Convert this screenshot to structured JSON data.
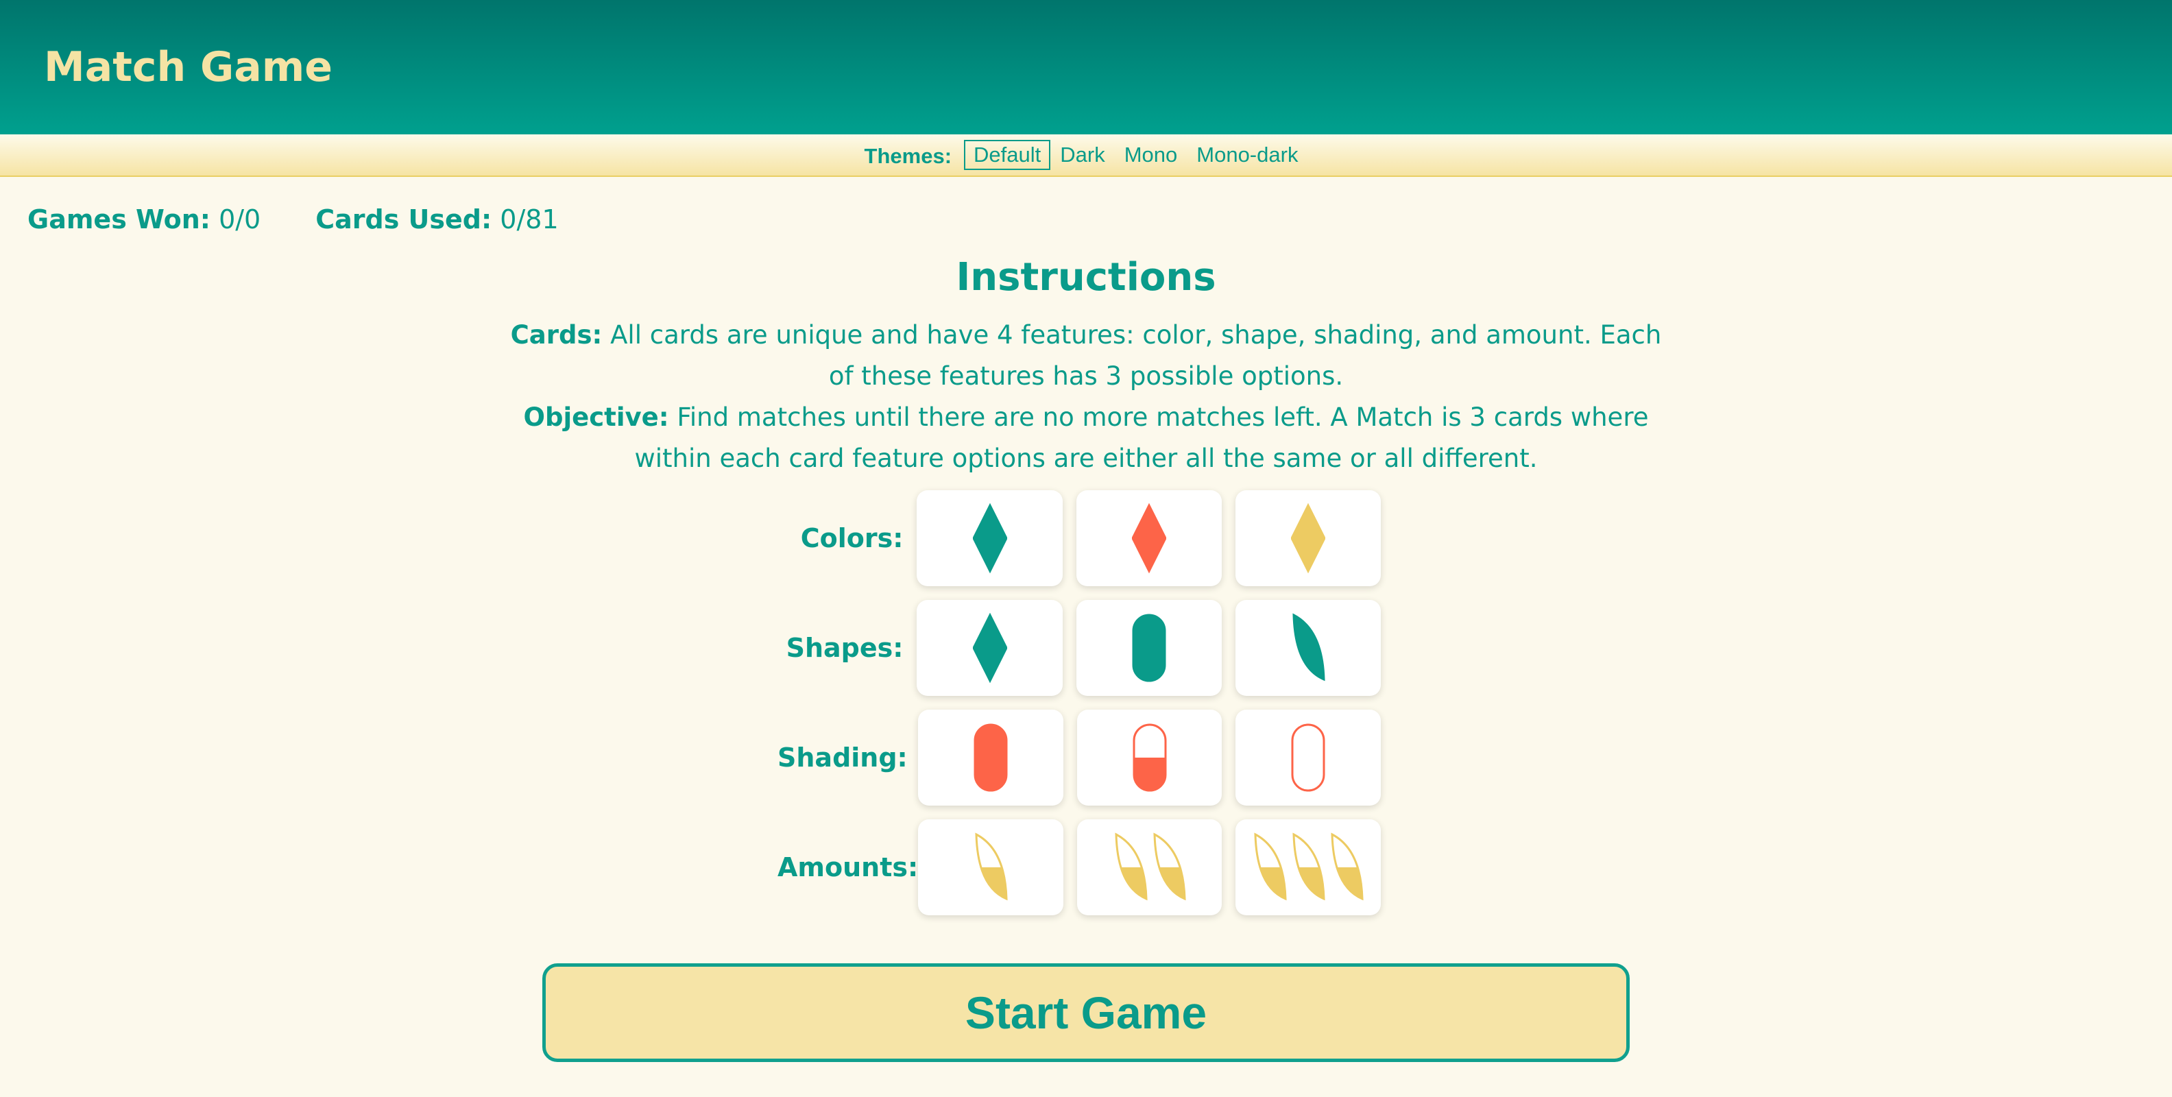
{
  "app": {
    "title": "Match Game"
  },
  "themes": {
    "label": "Themes:",
    "options": [
      "Default",
      "Dark",
      "Mono",
      "Mono-dark"
    ],
    "selected": "Default"
  },
  "stats": {
    "games_won_label": "Games Won:",
    "games_won_value": "0/0",
    "cards_used_label": "Cards Used:",
    "cards_used_value": "0/81"
  },
  "instructions": {
    "heading": "Instructions",
    "cards_label": "Cards:",
    "cards_text": "All cards are unique and have 4 features: color, shape, shading, and amount. Each of these features has 3 possible options.",
    "objective_label": "Objective:",
    "objective_text": "Find matches until there are no more matches left. A Match is 3 cards where within each card feature options are either all the same or all different."
  },
  "colors": {
    "teal": "#0a9b8a",
    "red": "#fd6448",
    "yellow": "#edcb62"
  },
  "examples": [
    {
      "label": "Colors:",
      "cards": [
        {
          "shape": "diamond",
          "color": "teal",
          "shading": "solid",
          "amount": 1
        },
        {
          "shape": "diamond",
          "color": "red",
          "shading": "solid",
          "amount": 1
        },
        {
          "shape": "diamond",
          "color": "yellow",
          "shading": "solid",
          "amount": 1
        }
      ]
    },
    {
      "label": "Shapes:",
      "cards": [
        {
          "shape": "diamond",
          "color": "teal",
          "shading": "solid",
          "amount": 1
        },
        {
          "shape": "oval",
          "color": "teal",
          "shading": "solid",
          "amount": 1
        },
        {
          "shape": "leaf",
          "color": "teal",
          "shading": "solid",
          "amount": 1
        }
      ]
    },
    {
      "label": "Shading:",
      "cards": [
        {
          "shape": "oval",
          "color": "red",
          "shading": "solid",
          "amount": 1
        },
        {
          "shape": "oval",
          "color": "red",
          "shading": "half",
          "amount": 1
        },
        {
          "shape": "oval",
          "color": "red",
          "shading": "empty",
          "amount": 1
        }
      ]
    },
    {
      "label": "Amounts:",
      "cards": [
        {
          "shape": "leaf",
          "color": "yellow",
          "shading": "half",
          "amount": 1
        },
        {
          "shape": "leaf",
          "color": "yellow",
          "shading": "half",
          "amount": 2
        },
        {
          "shape": "leaf",
          "color": "yellow",
          "shading": "half",
          "amount": 3
        }
      ]
    }
  ],
  "start_button": {
    "label": "Start Game"
  }
}
